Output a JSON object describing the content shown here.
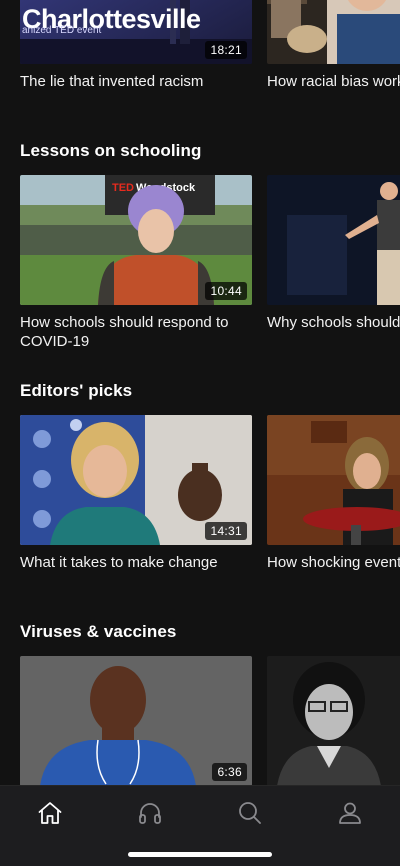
{
  "top_row": {
    "cards": [
      {
        "title": "The lie that invented racism",
        "duration": "18:21",
        "thumb_text": "Charlottesville",
        "thumb_subtext": "anized TED event"
      },
      {
        "title": "How racial bias works — and how to disrupt it",
        "duration": ""
      }
    ]
  },
  "sections": [
    {
      "title": "Lessons on schooling",
      "cards": [
        {
          "title": "How schools should respond to COVID-19",
          "duration": "10:44"
        },
        {
          "title": "Why schools should teach the real world",
          "duration": ""
        }
      ]
    },
    {
      "title": "Editors' picks",
      "cards": [
        {
          "title": "What it takes to make change",
          "duration": "14:31"
        },
        {
          "title": "How shocking events can spark positive change",
          "duration": ""
        }
      ]
    },
    {
      "title": "Viruses & vaccines",
      "cards": [
        {
          "title": "",
          "duration": "6:36"
        },
        {
          "title": "",
          "duration": ""
        }
      ]
    }
  ],
  "tabbar": {
    "tabs": [
      {
        "icon": "home-icon",
        "active": true
      },
      {
        "icon": "headphones-icon",
        "active": false
      },
      {
        "icon": "search-icon",
        "active": false
      },
      {
        "icon": "profile-icon",
        "active": false
      }
    ],
    "colors": {
      "active": "#ffffff",
      "inactive": "#8a8a8e"
    }
  },
  "theme": {
    "background": "#121212",
    "tabbar": "#1d1d1f",
    "accent": "#e62b1e"
  }
}
